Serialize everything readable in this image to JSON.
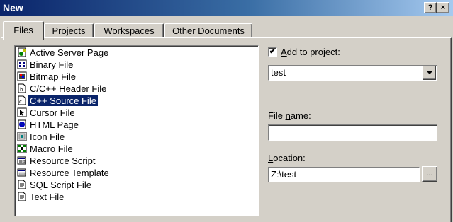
{
  "window": {
    "title": "New",
    "help_label": "?",
    "close_label": "×"
  },
  "tabs": [
    {
      "label": "Files",
      "active": true
    },
    {
      "label": "Projects",
      "active": false
    },
    {
      "label": "Workspaces",
      "active": false
    },
    {
      "label": "Other Documents",
      "active": false
    }
  ],
  "file_types": [
    {
      "label": "Active Server Page",
      "icon": "asp-icon"
    },
    {
      "label": "Binary File",
      "icon": "binary-file-icon"
    },
    {
      "label": "Bitmap File",
      "icon": "bitmap-file-icon"
    },
    {
      "label": "C/C++ Header File",
      "icon": "header-file-icon"
    },
    {
      "label": "C++ Source File",
      "icon": "source-file-icon",
      "selected": true
    },
    {
      "label": "Cursor File",
      "icon": "cursor-file-icon"
    },
    {
      "label": "HTML Page",
      "icon": "html-page-icon"
    },
    {
      "label": "Icon File",
      "icon": "icon-file-icon"
    },
    {
      "label": "Macro File",
      "icon": "macro-file-icon"
    },
    {
      "label": "Resource Script",
      "icon": "resource-script-icon"
    },
    {
      "label": "Resource Template",
      "icon": "resource-template-icon"
    },
    {
      "label": "SQL Script File",
      "icon": "sql-script-icon"
    },
    {
      "label": "Text File",
      "icon": "text-file-icon"
    }
  ],
  "add_to_project": {
    "label_ul": "A",
    "label_rest": "dd to project:",
    "checked": true,
    "check_mark": "✔",
    "project": "test"
  },
  "file_name": {
    "label_pre": "File ",
    "label_ul": "n",
    "label_rest": "ame:",
    "value": ""
  },
  "location": {
    "label_pre": "",
    "label_ul": "L",
    "label_rest": "ocation:",
    "value": "Z:\\test",
    "browse_label": "..."
  }
}
